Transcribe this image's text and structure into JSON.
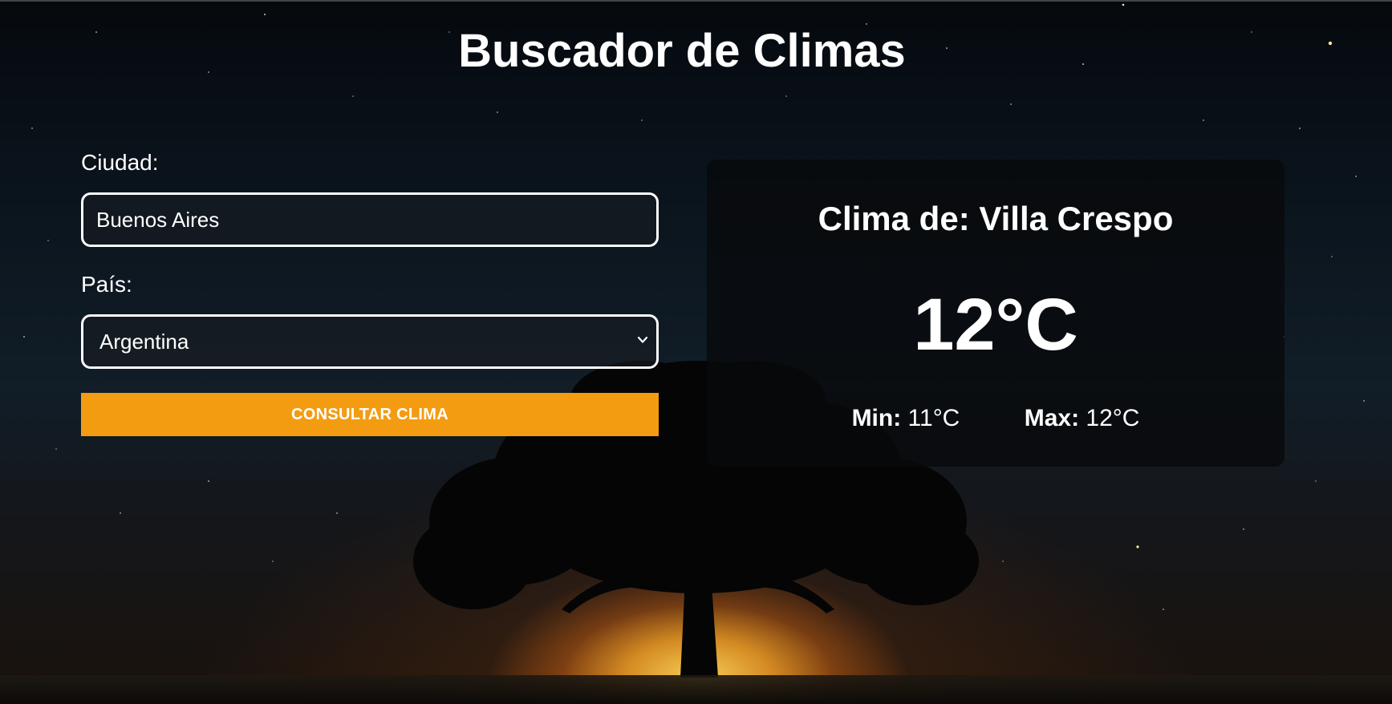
{
  "header": {
    "title": "Buscador de Climas"
  },
  "form": {
    "city_label": "Ciudad:",
    "city_value": "Buenos Aires",
    "country_label": "País:",
    "country_selected": "Argentina",
    "submit_label": "CONSULTAR CLIMA"
  },
  "result": {
    "title": "Clima de: Villa Crespo",
    "temperature": "12°C",
    "min_label": "Min:",
    "min_value": "11°C",
    "max_label": "Max:",
    "max_value": "12°C"
  },
  "colors": {
    "accent": "#f39c12",
    "text": "#ffffff",
    "card_bg": "#0a0c0e"
  },
  "icons": {
    "select_arrow": "chevron-down-icon"
  }
}
